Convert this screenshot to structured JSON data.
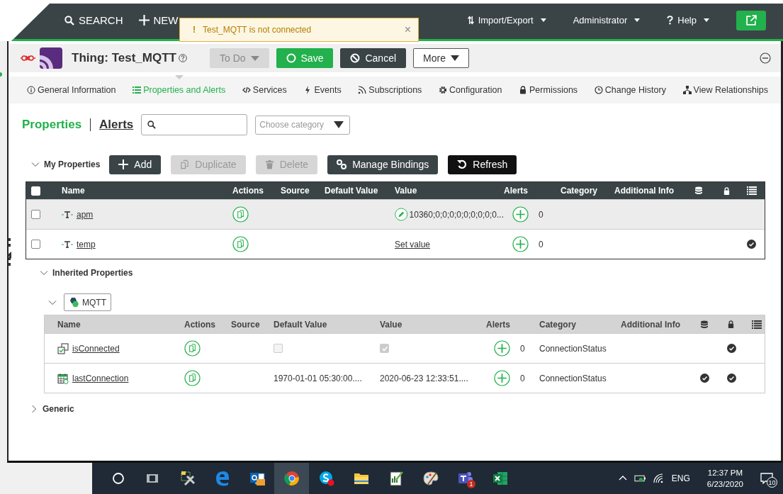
{
  "topbar": {
    "search": "SEARCH",
    "new": "NEW",
    "menus": [
      {
        "label": "Import/Export",
        "kind": "import"
      },
      {
        "label": "Administrator",
        "kind": "user"
      },
      {
        "label": "Help",
        "kind": "help"
      }
    ]
  },
  "toast": {
    "mark": "!",
    "message": "Test_MQTT is not connected",
    "close": "×"
  },
  "header": {
    "title": "Thing: Test_MQTT",
    "state": "To Do",
    "buttons": [
      {
        "label": "Save",
        "kind": "save"
      },
      {
        "label": "Cancel",
        "kind": "cancel"
      },
      {
        "label": "More",
        "kind": "more"
      }
    ]
  },
  "tabs": [
    {
      "label": "General Information",
      "kind": "info",
      "selected": false
    },
    {
      "label": "Properties and Alerts",
      "kind": "list",
      "selected": true
    },
    {
      "label": "Services",
      "kind": "code",
      "selected": false
    },
    {
      "label": "Events",
      "kind": "bolt",
      "selected": false
    },
    {
      "label": "Subscriptions",
      "kind": "feed",
      "selected": false
    },
    {
      "label": "Configuration",
      "kind": "gear",
      "selected": false
    },
    {
      "label": "Permissions",
      "kind": "lock",
      "selected": false
    },
    {
      "label": "Change History",
      "kind": "clock",
      "selected": false
    },
    {
      "label": "View Relationships",
      "kind": "tree",
      "selected": false
    }
  ],
  "subtabs": [
    {
      "label": "Properties",
      "selected": true
    },
    {
      "label": "Alerts",
      "selected": false
    }
  ],
  "category_filter": {
    "placeholder": "Choose category"
  },
  "my_properties": {
    "title": "My Properties",
    "expanded": true,
    "buttons": [
      {
        "label": "Add",
        "kind": "add",
        "disabled": false
      },
      {
        "label": "Duplicate",
        "kind": "duplicate",
        "disabled": true
      },
      {
        "label": "Delete",
        "kind": "delete",
        "disabled": true
      },
      {
        "label": "Manage Bindings",
        "kind": "bindings",
        "disabled": false
      },
      {
        "label": "Refresh",
        "kind": "refresh",
        "disabled": false
      }
    ],
    "table": {
      "select_all": {
        "checked": false
      },
      "columns": [
        "Name",
        "Actions",
        "Source",
        "Default Value",
        "Value",
        "Alerts",
        "Category",
        "Additional Info"
      ],
      "rows": [
        {
          "name": "apm",
          "kind": "string",
          "checked": false,
          "selected": true,
          "value": {
            "kind": "editable",
            "text": "10360;0;0;0;0;0;0;0;0;0..."
          },
          "alerts": "0",
          "persistent": false,
          "read_only": false,
          "logged": false
        },
        {
          "name": "temp",
          "kind": "string",
          "checked": false,
          "selected": false,
          "value": {
            "kind": "link",
            "text": "Set value"
          },
          "alerts": "0",
          "persistent": false,
          "read_only": false,
          "logged": true
        }
      ]
    }
  },
  "inherited": {
    "title": "Inherited Properties",
    "expanded": true,
    "groups": [
      {
        "name": "MQTT",
        "expanded": true,
        "table": {
          "columns": [
            "Name",
            "Actions",
            "Source",
            "Default Value",
            "Value",
            "Alerts",
            "Category",
            "Additional Info"
          ],
          "rows": [
            {
              "name": "isConnected",
              "kind": "boolean",
              "default": {
                "kind": "checkbox",
                "checked": false
              },
              "value": {
                "kind": "checkbox",
                "checked": true
              },
              "alerts": "0",
              "category": "ConnectionStatus",
              "persistent": false,
              "read_only": true,
              "logged": false
            },
            {
              "name": "lastConnection",
              "kind": "datetime",
              "default": {
                "kind": "text",
                "text": "1970-01-01 05:30:00...."
              },
              "value": {
                "kind": "text",
                "text": "2020-06-23 12:33:51...."
              },
              "alerts": "0",
              "category": "ConnectionStatus",
              "persistent": true,
              "read_only": true,
              "logged": false
            }
          ]
        }
      }
    ]
  },
  "generic": {
    "title": "Generic",
    "expanded": false
  },
  "taskbar": {
    "apps": [
      {
        "kind": "tools",
        "selected": false
      },
      {
        "kind": "edge",
        "selected": false
      },
      {
        "kind": "mail",
        "selected": false
      },
      {
        "kind": "chrome",
        "selected": true
      },
      {
        "kind": "chat",
        "selected": false
      },
      {
        "kind": "folder",
        "selected": false
      },
      {
        "kind": "document",
        "selected": false
      },
      {
        "kind": "palette",
        "selected": false
      },
      {
        "kind": "teams",
        "selected": false,
        "badge": "1"
      },
      {
        "kind": "sheet",
        "selected": false
      }
    ],
    "language": "ENG",
    "time": "12:37 PM",
    "date": "6/23/2020",
    "notifications": "10"
  }
}
